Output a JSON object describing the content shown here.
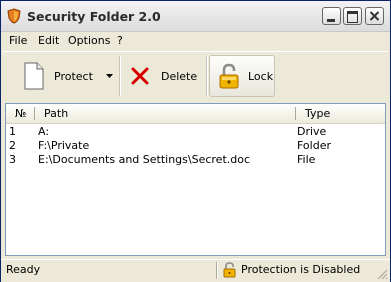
{
  "window": {
    "title": "Security Folder 2.0"
  },
  "menu": {
    "items": [
      "File",
      "Edit",
      "Options",
      "?"
    ]
  },
  "toolbar": {
    "protect_label": "Protect",
    "delete_label": "Delete",
    "lock_label": "Lock"
  },
  "list": {
    "columns": [
      "№",
      "Path",
      "Type"
    ],
    "rows": [
      {
        "num": "1",
        "path": "A:",
        "type": "Drive"
      },
      {
        "num": "2",
        "path": "F:\\Private",
        "type": "Folder"
      },
      {
        "num": "3",
        "path": "E:\\Documents and Settings\\Secret.doc",
        "type": "File"
      }
    ]
  },
  "status": {
    "left": "Ready",
    "right": "Protection is Disabled"
  },
  "colors": {
    "titlebar": "#dcdcdc",
    "face": "#ece9d8",
    "delete_x": "#d40000"
  },
  "icons": [
    "shield-icon",
    "minimize-icon",
    "maximize-icon",
    "close-icon",
    "document-icon",
    "dropdown-arrow-icon",
    "delete-x-icon",
    "padlock-open-icon",
    "resize-grip-icon"
  ]
}
